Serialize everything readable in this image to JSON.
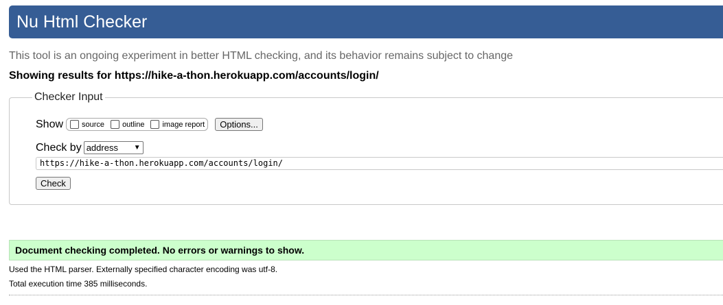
{
  "header": {
    "title": "Nu Html Checker"
  },
  "subtitle": "This tool is an ongoing experiment in better HTML checking, and its behavior remains subject to change",
  "results_heading": "Showing results for https://hike-a-thon.herokuapp.com/accounts/login/",
  "checker_input": {
    "legend": "Checker Input",
    "show_label": "Show",
    "show_options": [
      {
        "label": "source",
        "checked": false
      },
      {
        "label": "outline",
        "checked": false
      },
      {
        "label": "image report",
        "checked": false
      }
    ],
    "options_button": "Options...",
    "check_by_label": "Check by",
    "check_by_value": "address",
    "url_value": "https://hike-a-thon.herokuapp.com/accounts/login/",
    "check_button": "Check"
  },
  "result": {
    "message": "Document checking completed. No errors or warnings to show.",
    "parser_info": "Used the HTML parser. Externally specified character encoding was utf-8.",
    "timing": "Total execution time 385 milliseconds."
  },
  "colors": {
    "header_bg": "#365d95",
    "success_bg": "#ccffcc"
  }
}
